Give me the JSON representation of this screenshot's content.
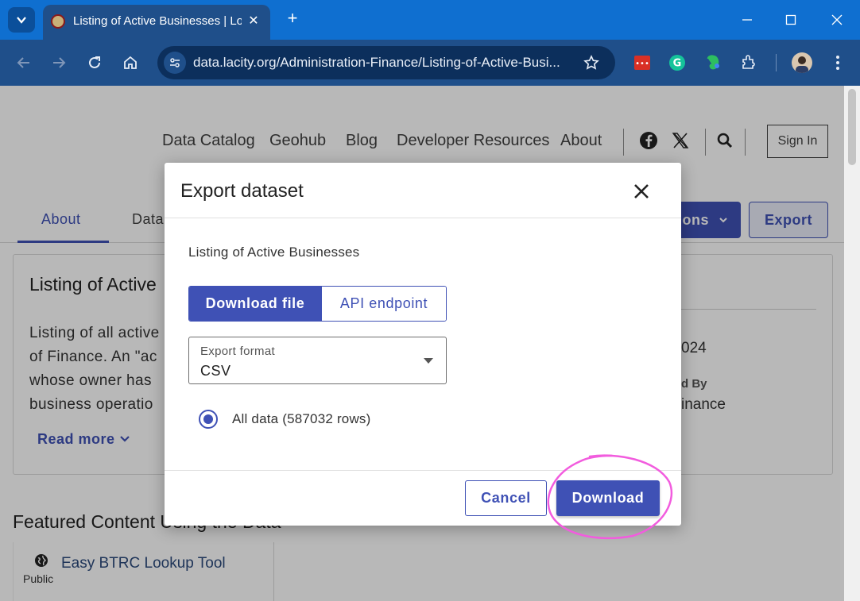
{
  "browser": {
    "tab_title": "Listing of Active Businesses | Lo",
    "url": "data.lacity.org/Administration-Finance/Listing-of-Active-Busi..."
  },
  "header": {
    "nav": [
      "Data Catalog",
      "Geohub",
      "Blog",
      "Developer Resources",
      "About"
    ],
    "sign_in": "Sign In"
  },
  "subnav": {
    "tabs": [
      "About",
      "Data"
    ],
    "actions_label": "ons",
    "export_label": "Export"
  },
  "card": {
    "title": "Listing of Active",
    "description_lines": [
      "Listing of all active",
      "of Finance. An \"ac",
      "whose owner has",
      "business operatio"
    ],
    "read_more": "Read more",
    "meta_value_1": "024",
    "meta_label_2": "d By",
    "meta_value_2": "inance"
  },
  "featured": {
    "heading": "Featured Content Using the Data",
    "item_title": "Easy BTRC Lookup Tool",
    "item_visibility": "Public"
  },
  "modal": {
    "title": "Export dataset",
    "dataset_name": "Listing of Active Businesses",
    "segments": [
      "Download file",
      "API endpoint"
    ],
    "format_label": "Export format",
    "format_value": "CSV",
    "radio_label": "All data (587032 rows)",
    "cancel": "Cancel",
    "download": "Download"
  },
  "colors": {
    "accent": "#3f51b5",
    "chrome_title": "#0f6fd0",
    "chrome_toolbar": "#1f4f8a",
    "annotation": "#f25cde"
  }
}
